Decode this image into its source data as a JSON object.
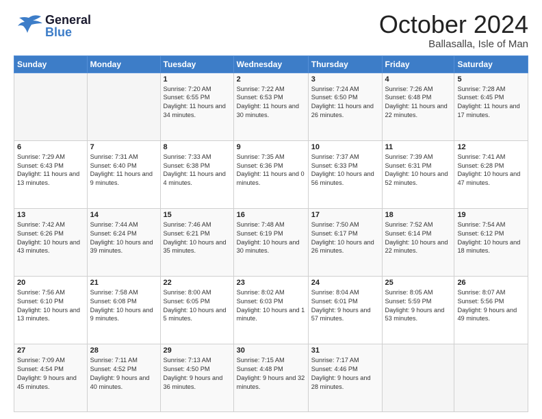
{
  "header": {
    "logo_general": "General",
    "logo_blue": "Blue",
    "main_title": "October 2024",
    "subtitle": "Ballasalla, Isle of Man"
  },
  "days": [
    "Sunday",
    "Monday",
    "Tuesday",
    "Wednesday",
    "Thursday",
    "Friday",
    "Saturday"
  ],
  "weeks": [
    [
      {
        "date": "",
        "sunrise": "",
        "sunset": "",
        "daylight": ""
      },
      {
        "date": "",
        "sunrise": "",
        "sunset": "",
        "daylight": ""
      },
      {
        "date": "1",
        "sunrise": "Sunrise: 7:20 AM",
        "sunset": "Sunset: 6:55 PM",
        "daylight": "Daylight: 11 hours and 34 minutes."
      },
      {
        "date": "2",
        "sunrise": "Sunrise: 7:22 AM",
        "sunset": "Sunset: 6:53 PM",
        "daylight": "Daylight: 11 hours and 30 minutes."
      },
      {
        "date": "3",
        "sunrise": "Sunrise: 7:24 AM",
        "sunset": "Sunset: 6:50 PM",
        "daylight": "Daylight: 11 hours and 26 minutes."
      },
      {
        "date": "4",
        "sunrise": "Sunrise: 7:26 AM",
        "sunset": "Sunset: 6:48 PM",
        "daylight": "Daylight: 11 hours and 22 minutes."
      },
      {
        "date": "5",
        "sunrise": "Sunrise: 7:28 AM",
        "sunset": "Sunset: 6:45 PM",
        "daylight": "Daylight: 11 hours and 17 minutes."
      }
    ],
    [
      {
        "date": "6",
        "sunrise": "Sunrise: 7:29 AM",
        "sunset": "Sunset: 6:43 PM",
        "daylight": "Daylight: 11 hours and 13 minutes."
      },
      {
        "date": "7",
        "sunrise": "Sunrise: 7:31 AM",
        "sunset": "Sunset: 6:40 PM",
        "daylight": "Daylight: 11 hours and 9 minutes."
      },
      {
        "date": "8",
        "sunrise": "Sunrise: 7:33 AM",
        "sunset": "Sunset: 6:38 PM",
        "daylight": "Daylight: 11 hours and 4 minutes."
      },
      {
        "date": "9",
        "sunrise": "Sunrise: 7:35 AM",
        "sunset": "Sunset: 6:36 PM",
        "daylight": "Daylight: 11 hours and 0 minutes."
      },
      {
        "date": "10",
        "sunrise": "Sunrise: 7:37 AM",
        "sunset": "Sunset: 6:33 PM",
        "daylight": "Daylight: 10 hours and 56 minutes."
      },
      {
        "date": "11",
        "sunrise": "Sunrise: 7:39 AM",
        "sunset": "Sunset: 6:31 PM",
        "daylight": "Daylight: 10 hours and 52 minutes."
      },
      {
        "date": "12",
        "sunrise": "Sunrise: 7:41 AM",
        "sunset": "Sunset: 6:28 PM",
        "daylight": "Daylight: 10 hours and 47 minutes."
      }
    ],
    [
      {
        "date": "13",
        "sunrise": "Sunrise: 7:42 AM",
        "sunset": "Sunset: 6:26 PM",
        "daylight": "Daylight: 10 hours and 43 minutes."
      },
      {
        "date": "14",
        "sunrise": "Sunrise: 7:44 AM",
        "sunset": "Sunset: 6:24 PM",
        "daylight": "Daylight: 10 hours and 39 minutes."
      },
      {
        "date": "15",
        "sunrise": "Sunrise: 7:46 AM",
        "sunset": "Sunset: 6:21 PM",
        "daylight": "Daylight: 10 hours and 35 minutes."
      },
      {
        "date": "16",
        "sunrise": "Sunrise: 7:48 AM",
        "sunset": "Sunset: 6:19 PM",
        "daylight": "Daylight: 10 hours and 30 minutes."
      },
      {
        "date": "17",
        "sunrise": "Sunrise: 7:50 AM",
        "sunset": "Sunset: 6:17 PM",
        "daylight": "Daylight: 10 hours and 26 minutes."
      },
      {
        "date": "18",
        "sunrise": "Sunrise: 7:52 AM",
        "sunset": "Sunset: 6:14 PM",
        "daylight": "Daylight: 10 hours and 22 minutes."
      },
      {
        "date": "19",
        "sunrise": "Sunrise: 7:54 AM",
        "sunset": "Sunset: 6:12 PM",
        "daylight": "Daylight: 10 hours and 18 minutes."
      }
    ],
    [
      {
        "date": "20",
        "sunrise": "Sunrise: 7:56 AM",
        "sunset": "Sunset: 6:10 PM",
        "daylight": "Daylight: 10 hours and 13 minutes."
      },
      {
        "date": "21",
        "sunrise": "Sunrise: 7:58 AM",
        "sunset": "Sunset: 6:08 PM",
        "daylight": "Daylight: 10 hours and 9 minutes."
      },
      {
        "date": "22",
        "sunrise": "Sunrise: 8:00 AM",
        "sunset": "Sunset: 6:05 PM",
        "daylight": "Daylight: 10 hours and 5 minutes."
      },
      {
        "date": "23",
        "sunrise": "Sunrise: 8:02 AM",
        "sunset": "Sunset: 6:03 PM",
        "daylight": "Daylight: 10 hours and 1 minute."
      },
      {
        "date": "24",
        "sunrise": "Sunrise: 8:04 AM",
        "sunset": "Sunset: 6:01 PM",
        "daylight": "Daylight: 9 hours and 57 minutes."
      },
      {
        "date": "25",
        "sunrise": "Sunrise: 8:05 AM",
        "sunset": "Sunset: 5:59 PM",
        "daylight": "Daylight: 9 hours and 53 minutes."
      },
      {
        "date": "26",
        "sunrise": "Sunrise: 8:07 AM",
        "sunset": "Sunset: 5:56 PM",
        "daylight": "Daylight: 9 hours and 49 minutes."
      }
    ],
    [
      {
        "date": "27",
        "sunrise": "Sunrise: 7:09 AM",
        "sunset": "Sunset: 4:54 PM",
        "daylight": "Daylight: 9 hours and 45 minutes."
      },
      {
        "date": "28",
        "sunrise": "Sunrise: 7:11 AM",
        "sunset": "Sunset: 4:52 PM",
        "daylight": "Daylight: 9 hours and 40 minutes."
      },
      {
        "date": "29",
        "sunrise": "Sunrise: 7:13 AM",
        "sunset": "Sunset: 4:50 PM",
        "daylight": "Daylight: 9 hours and 36 minutes."
      },
      {
        "date": "30",
        "sunrise": "Sunrise: 7:15 AM",
        "sunset": "Sunset: 4:48 PM",
        "daylight": "Daylight: 9 hours and 32 minutes."
      },
      {
        "date": "31",
        "sunrise": "Sunrise: 7:17 AM",
        "sunset": "Sunset: 4:46 PM",
        "daylight": "Daylight: 9 hours and 28 minutes."
      },
      {
        "date": "",
        "sunrise": "",
        "sunset": "",
        "daylight": ""
      },
      {
        "date": "",
        "sunrise": "",
        "sunset": "",
        "daylight": ""
      }
    ]
  ]
}
